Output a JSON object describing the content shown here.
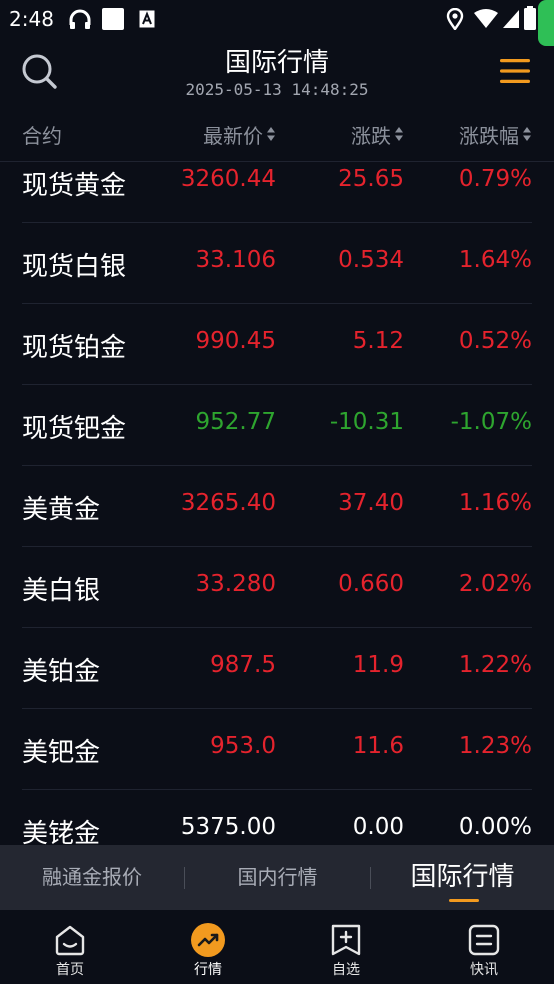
{
  "status_bar": {
    "time": "2:48"
  },
  "header": {
    "title": "国际行情",
    "timestamp": "2025-05-13 14:48:25"
  },
  "columns": {
    "name": "合约",
    "price": "最新价",
    "change": "涨跌",
    "pct": "涨跌幅"
  },
  "colors": {
    "up": "#e5232d",
    "down": "#2ea52f",
    "flat": "#ffffff",
    "accent": "#f29a1f"
  },
  "rows": [
    {
      "name": "现货黄金",
      "price": "3260.44",
      "change": "25.65",
      "pct": "0.79%",
      "trend": "up"
    },
    {
      "name": "现货白银",
      "price": "33.106",
      "change": "0.534",
      "pct": "1.64%",
      "trend": "up"
    },
    {
      "name": "现货铂金",
      "price": "990.45",
      "change": "5.12",
      "pct": "0.52%",
      "trend": "up"
    },
    {
      "name": "现货钯金",
      "price": "952.77",
      "change": "-10.31",
      "pct": "-1.07%",
      "trend": "down"
    },
    {
      "name": "美黄金",
      "price": "3265.40",
      "change": "37.40",
      "pct": "1.16%",
      "trend": "up"
    },
    {
      "name": "美白银",
      "price": "33.280",
      "change": "0.660",
      "pct": "2.02%",
      "trend": "up"
    },
    {
      "name": "美铂金",
      "price": "987.5",
      "change": "11.9",
      "pct": "1.22%",
      "trend": "up"
    },
    {
      "name": "美钯金",
      "price": "953.0",
      "change": "11.6",
      "pct": "1.23%",
      "trend": "up"
    },
    {
      "name": "美铑金",
      "price": "5375.00",
      "change": "0.00",
      "pct": "0.00%",
      "trend": "flat"
    }
  ],
  "subtabs": [
    {
      "label": "融通金报价",
      "active": false
    },
    {
      "label": "国内行情",
      "active": false
    },
    {
      "label": "国际行情",
      "active": true
    }
  ],
  "bottom_nav": [
    {
      "label": "首页",
      "icon": "home-icon",
      "active": false
    },
    {
      "label": "行情",
      "icon": "market-trend-icon",
      "active": true
    },
    {
      "label": "自选",
      "icon": "add-favorite-icon",
      "active": false
    },
    {
      "label": "快讯",
      "icon": "news-flash-icon",
      "active": false
    }
  ]
}
